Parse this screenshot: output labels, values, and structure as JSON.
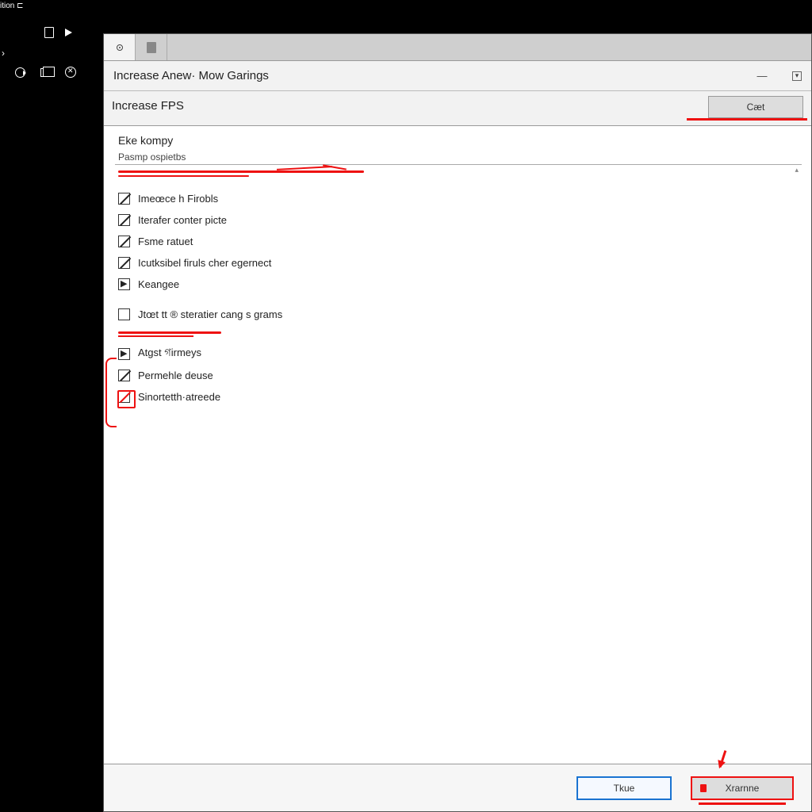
{
  "darkbar": {
    "label": "ition  ⊏"
  },
  "dialog": {
    "title": "Increase Anew· Mow Garings",
    "toolbar": {
      "section": "Increase FPS",
      "cast_btn": "Cæt"
    },
    "group": {
      "title": "Eke kompy",
      "subtitle": "Pasmp ospietbs"
    },
    "checks": [
      {
        "label": "Imeœce h Firobls",
        "style": "slash"
      },
      {
        "label": "Iterafer conter picte",
        "style": "slash"
      },
      {
        "label": "Fsme ratuet",
        "style": "slash"
      },
      {
        "label": "Icutksibel firuls cher egernect",
        "style": "slash"
      },
      {
        "label": "Keangee",
        "style": "arrow"
      },
      {
        "label": "Jtœt tt ® steratier cang s grams",
        "style": "empty"
      },
      {
        "label": "Atgst গirmeys",
        "style": "arrow"
      },
      {
        "label": "Permehle deuse",
        "style": "slash"
      },
      {
        "label": "Sinortetth·atreede",
        "style": "redover"
      }
    ],
    "footer": {
      "left_btn": "Tkue",
      "right_btn": "Xrarnne"
    }
  }
}
